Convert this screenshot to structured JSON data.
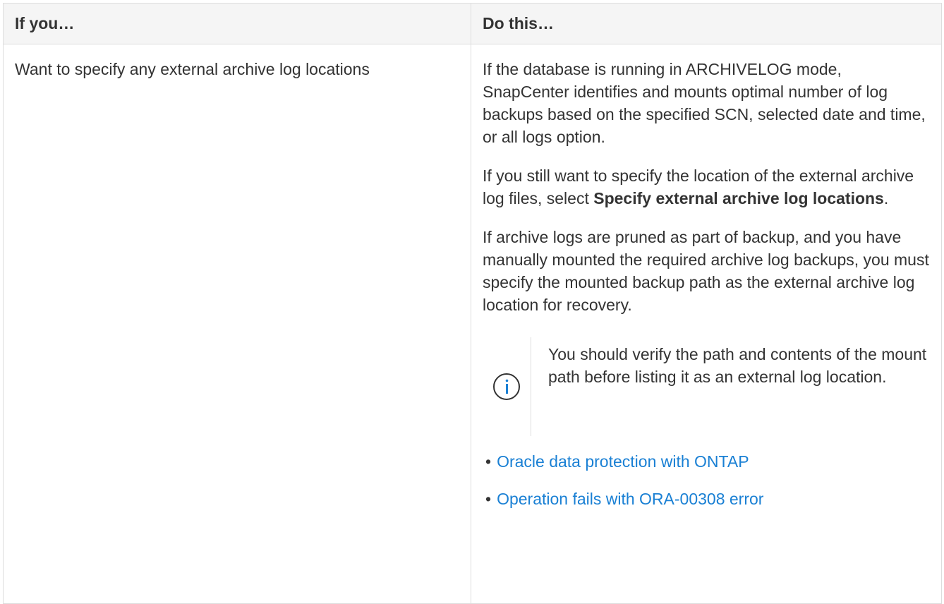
{
  "table": {
    "headers": [
      "If you…",
      "Do this…"
    ],
    "row": {
      "condition": "Want to specify any external archive log locations",
      "para1": "If the database is running in ARCHIVELOG mode, SnapCenter identifies and mounts optimal number of log backups based on the specified SCN, selected date and time, or all logs option.",
      "para2_before": "If you still want to specify the location of the external archive log files, select ",
      "para2_bold": "Specify external archive log locations",
      "para2_after": ".",
      "para3": "If archive logs are pruned as part of backup, and you have manually mounted the required archive log backups, you must specify the mounted backup path as the external archive log location for recovery.",
      "note": {
        "icon": "info-icon",
        "text": "You should verify the path and contents of the mount path before listing it as an external log location."
      },
      "links": [
        {
          "label": "Oracle data protection with ONTAP"
        },
        {
          "label": "Operation fails with ORA-00308 error"
        }
      ]
    }
  },
  "colors": {
    "link": "#1a80d4",
    "text": "#333333",
    "header_bg": "#f5f5f5",
    "border": "#dddddd"
  }
}
